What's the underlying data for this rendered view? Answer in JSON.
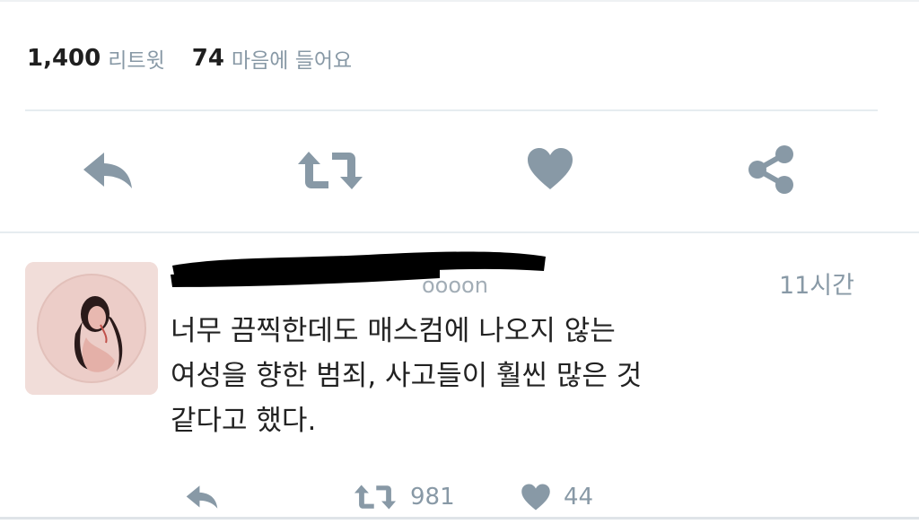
{
  "stats": {
    "retweets": "1,400",
    "retweets_label": "리트윗",
    "likes": "74",
    "likes_label": "마음에 들어요"
  },
  "reply": {
    "handle_visible": "oooon",
    "timestamp": "11시간",
    "text_lines": [
      "너무 끔찍한데도 매스컴에 나오지 않는",
      "여성을 향한 범죄, 사고들이 훨씬 많은 것",
      "같다고 했다."
    ],
    "retweet_count": "981",
    "like_count": "44"
  },
  "icons": {
    "reply": "reply-icon",
    "retweet": "retweet-icon",
    "like": "heart-icon",
    "share": "share-icon"
  },
  "colors": {
    "icon": "#8899a6",
    "muted_text": "#8899a6",
    "divider": "#e6ecf0"
  }
}
